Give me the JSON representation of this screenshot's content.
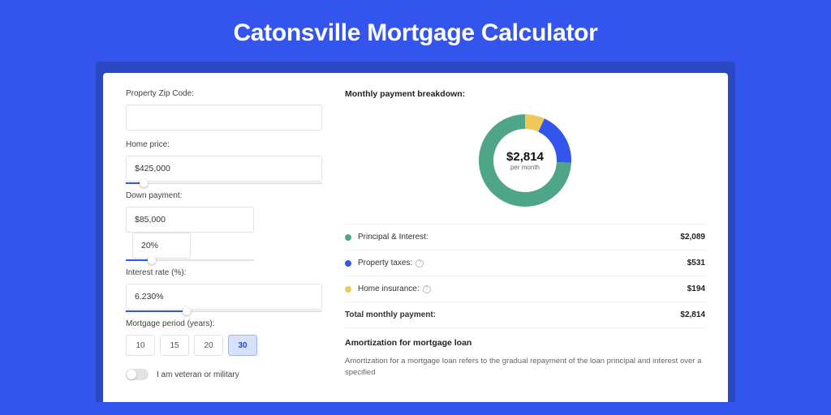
{
  "page_title": "Catonsville Mortgage Calculator",
  "form": {
    "zip_label": "Property Zip Code:",
    "zip_value": "",
    "price_label": "Home price:",
    "price_value": "$425,000",
    "price_slider_pct": 9,
    "down_label": "Down payment:",
    "down_value": "$85,000",
    "down_pct": "20%",
    "down_slider_pct": 20,
    "rate_label": "Interest rate (%):",
    "rate_value": "6.230%",
    "rate_slider_pct": 31,
    "period_label": "Mortgage period (years):",
    "periods": [
      "10",
      "15",
      "20",
      "30"
    ],
    "period_active": "30",
    "veteran_label": "I am veteran or military"
  },
  "breakdown": {
    "heading": "Monthly payment breakdown:",
    "center_amount": "$2,814",
    "center_sub": "per month",
    "rows": [
      {
        "color": "#4ea687",
        "label": "Principal & Interest:",
        "value": "$2,089",
        "info": false
      },
      {
        "color": "#3355ee",
        "label": "Property taxes:",
        "value": "$531",
        "info": true
      },
      {
        "color": "#f0c95b",
        "label": "Home insurance:",
        "value": "$194",
        "info": true
      }
    ],
    "total_label": "Total monthly payment:",
    "total_value": "$2,814"
  },
  "chart_data": {
    "type": "pie",
    "title": "Monthly payment breakdown",
    "categories": [
      "Principal & Interest",
      "Property taxes",
      "Home insurance"
    ],
    "values": [
      2089,
      531,
      194
    ],
    "colors": [
      "#4ea687",
      "#3355ee",
      "#f0c95b"
    ],
    "total": 2814
  },
  "amort": {
    "heading": "Amortization for mortgage loan",
    "body": "Amortization for a mortgage loan refers to the gradual repayment of the loan principal and interest over a specified"
  }
}
